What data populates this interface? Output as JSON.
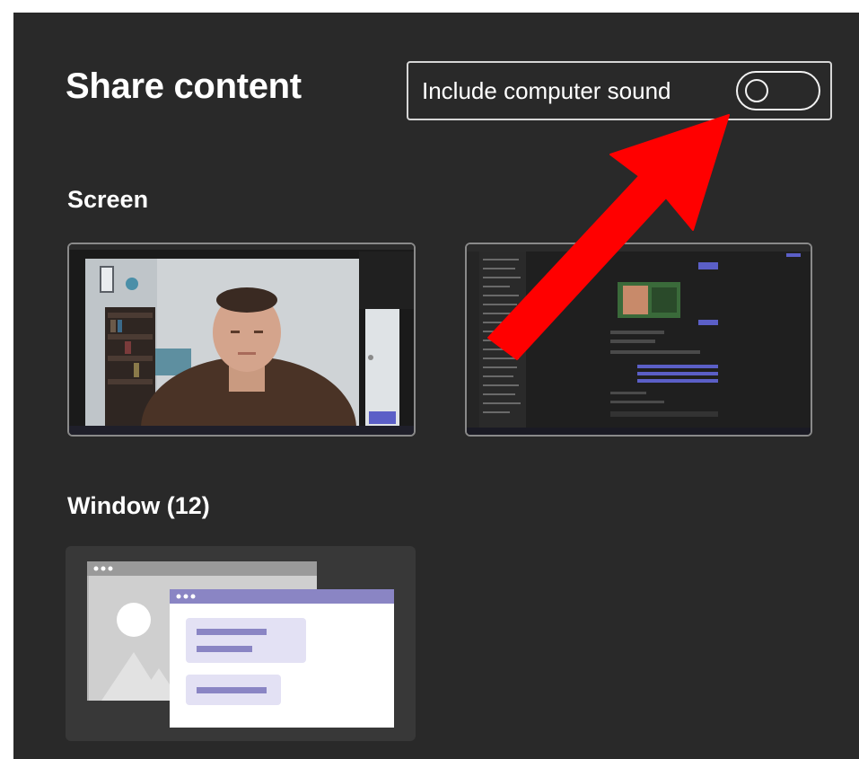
{
  "panel": {
    "title": "Share content"
  },
  "sound_toggle": {
    "label": "Include computer sound",
    "state": "off"
  },
  "sections": {
    "screen": {
      "heading": "Screen",
      "thumbnails": [
        {
          "description": "screen-1"
        },
        {
          "description": "screen-2"
        }
      ]
    },
    "window": {
      "heading": "Window (12)"
    }
  },
  "colors": {
    "panel_bg": "#292929",
    "arrow": "#ff0000",
    "accent_purple": "#8a85c4"
  }
}
